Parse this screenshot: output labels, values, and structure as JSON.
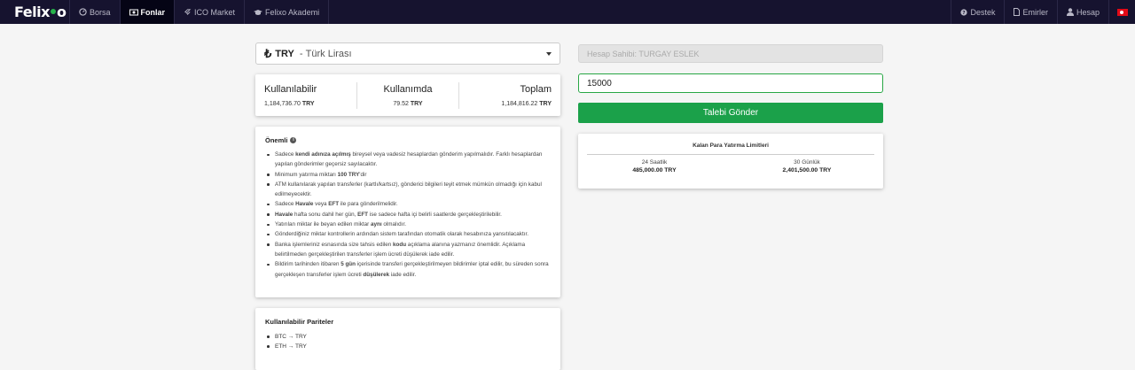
{
  "nav": {
    "logo": "Felixo",
    "items": [
      {
        "label": "Borsa",
        "icon": "gauge-icon"
      },
      {
        "label": "Fonlar",
        "icon": "money-bill-icon",
        "active": true
      },
      {
        "label": "ICO Market",
        "icon": "rocket-icon"
      },
      {
        "label": "Felixo Akademi",
        "icon": "graduation-cap-icon"
      }
    ],
    "right_items": [
      {
        "label": "Destek",
        "icon": "question-circle-icon"
      },
      {
        "label": "Emirler",
        "icon": "file-icon"
      },
      {
        "label": "Hesap",
        "icon": "user-icon"
      }
    ],
    "flag": "turkey-flag-icon"
  },
  "currency": {
    "symbol": "₺",
    "code": "TRY",
    "separator": " - ",
    "name": "Türk Lirası"
  },
  "balances": {
    "available": {
      "label": "Kullanılabilir",
      "amount": "1,184,736.70",
      "unit": "TRY"
    },
    "in_use": {
      "label": "Kullanımda",
      "amount": "79.52",
      "unit": "TRY"
    },
    "total": {
      "label": "Toplam",
      "amount": "1,184,816.22",
      "unit": "TRY"
    }
  },
  "notice": {
    "title": "Önemli",
    "items": [
      [
        "Sadece ",
        "kendi adınıza açılmış",
        " bireysel veya vadesiz hesaplardan gönderim yapılmalıdır. Farklı hesaplardan yapılan gönderimler geçersiz sayılacaktır."
      ],
      [
        "Minimum yatırma miktarı ",
        "100 TRY",
        "'dir"
      ],
      [
        "ATM kullanılarak yapılan transferler (kartlı/kartsız), gönderici bilgileri teyit etmek mümkün olmadığı için kabul edilmeyecektir.",
        "",
        ""
      ],
      [
        "Sadece ",
        "Havale",
        " veya ",
        "EFT",
        " ile para gönderilmelidir."
      ],
      [
        "",
        "Havale",
        " hafta sonu dahil her gün, ",
        "EFT",
        " ise sadece hafta içi belirli saatlerde gerçekleştirilebilir."
      ],
      [
        "Yatırılan miktar ile beyan edilen miktar ",
        "aynı",
        " olmalıdır."
      ],
      [
        "Gönderdiğiniz miktar kontrollerin ardından sistem tarafından otomatik olarak hesabınıza yansıtılacaktır.",
        "",
        ""
      ],
      [
        "Banka işlemleriniz esnasında size tahsis edilen ",
        "kodu",
        " açıklama alanına yazmanız önemlidir. Açıklama belirtilmeden gerçekleştirilen transferler işlem ücreti düşülerek iade edilir."
      ],
      [
        "Bildirim tarihinden itibaren ",
        "5 gün",
        " içerisinde transferi gerçekleştirilmeyen bildirimler iptal edilir, bu süreden sonra gerçekleşen transferler işlem ücreti ",
        "düşülerek",
        " iade edilir."
      ]
    ]
  },
  "pairs": {
    "title": "Kullanılabilir Pariteler",
    "items": [
      "BTC → TRY",
      "ETH → TRY"
    ]
  },
  "form": {
    "holder_placeholder": "Hesap Sahibi: TURGAY ESLEK",
    "amount_value": "15000",
    "submit_label": "Talebi Gönder"
  },
  "limits": {
    "title": "Kalan Para Yatırma Limitleri",
    "daily24": {
      "label": "24 Saatlik",
      "value": "485,000.00 TRY"
    },
    "days30": {
      "label": "30 Günlük",
      "value": "2,401,500.00 TRY"
    }
  }
}
